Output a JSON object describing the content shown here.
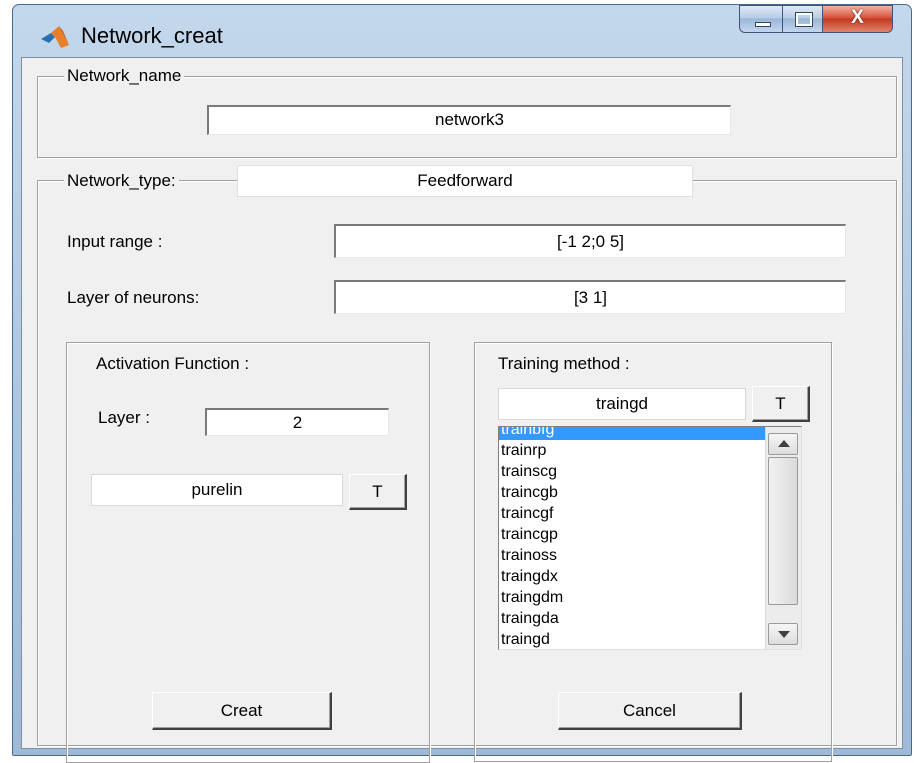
{
  "window": {
    "title": "Network_creat",
    "close_glyph": "X"
  },
  "network_name": {
    "group_title": "Network_name",
    "value": "network3"
  },
  "network_type": {
    "group_title": "Network_type:",
    "value": "Feedforward"
  },
  "input_range": {
    "label": "Input range :",
    "value": "[-1 2;0 5]"
  },
  "layers": {
    "label": "Layer of neurons:",
    "value": "[3 1]"
  },
  "activation": {
    "group_title": "Activation Function :",
    "layer_label": "Layer :",
    "layer_value": "2",
    "function_value": "purelin",
    "t_button": "T"
  },
  "training": {
    "group_title": "Training method :",
    "value": "traingd",
    "t_button": "T",
    "list_items": [
      "trainbfg",
      "trainrp",
      "trainscg",
      "traincgb",
      "traincgf",
      "traincgp",
      "trainoss",
      "traingdx",
      "traingdm",
      "traingda",
      "traingd"
    ],
    "selected_index": 0
  },
  "buttons": {
    "create": "Creat",
    "cancel": "Cancel"
  },
  "icons": {
    "app": "matlab-logo-icon",
    "minimize": "minimize-icon",
    "maximize": "maximize-icon",
    "close": "close-icon"
  }
}
